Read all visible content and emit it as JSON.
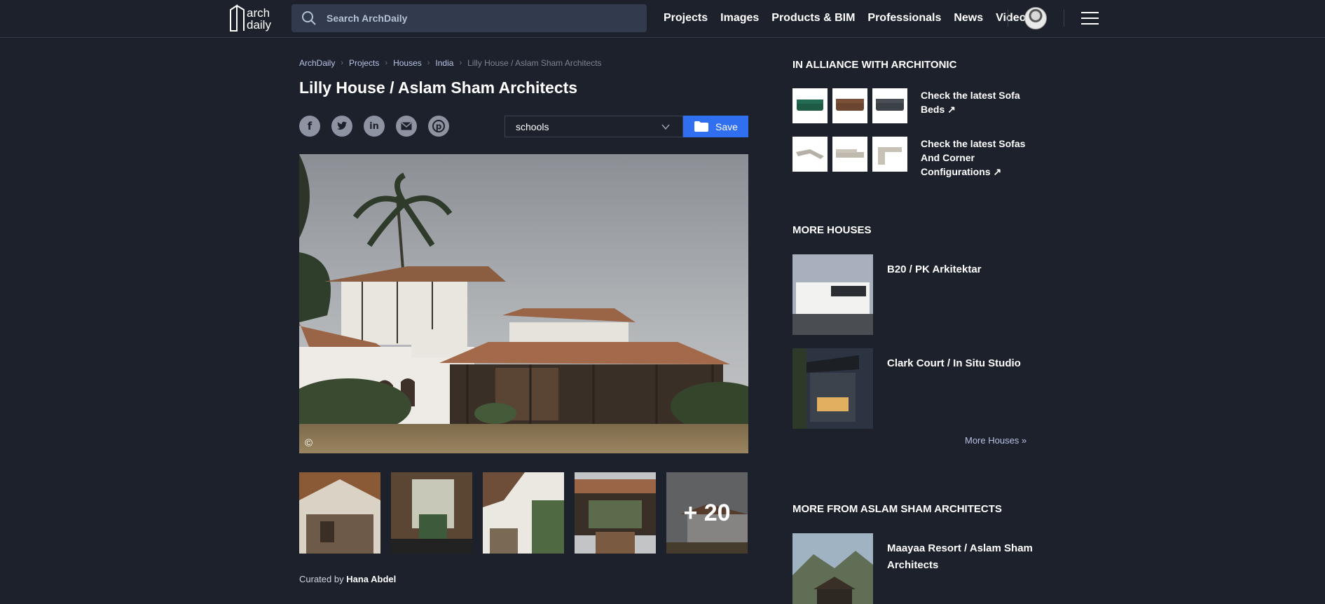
{
  "header": {
    "logo_line1": "arch",
    "logo_line2": "daily",
    "search_placeholder": "Search ArchDaily",
    "nav": [
      "Projects",
      "Images",
      "Products & BIM",
      "Professionals",
      "News",
      "Videos"
    ]
  },
  "breadcrumb": [
    "ArchDaily",
    "Projects",
    "Houses",
    "India",
    "Lilly House / Aslam Sham Architects"
  ],
  "title": "Lilly House / Aslam Sham Architects",
  "share_icons": [
    "facebook-icon",
    "twitter-icon",
    "linkedin-icon",
    "email-icon",
    "pinterest-icon"
  ],
  "folder_select": {
    "value": "schools"
  },
  "save_label": "Save",
  "main_image": {
    "copyright": "©"
  },
  "thumbs": {
    "more_count": "+ 20"
  },
  "curated": {
    "prefix": "Curated by ",
    "name": "Hana Abdel"
  },
  "sidebar": {
    "alliance": {
      "heading": "IN ALLIANCE WITH ARCHITONIC",
      "rows": [
        {
          "text": "Check the latest Sofa Beds"
        },
        {
          "text": "Check the latest Sofas And Corner Configurations"
        }
      ]
    },
    "more_houses": {
      "heading": "MORE HOUSES",
      "items": [
        {
          "title": "B20 / PK Arkitektar"
        },
        {
          "title": "Clark Court / In Situ Studio"
        }
      ],
      "link": "More Houses »"
    },
    "more_from": {
      "heading": "MORE FROM ASLAM SHAM ARCHITECTS",
      "items": [
        {
          "title": "Maayaa Resort / Aslam Sham Architects"
        }
      ]
    }
  },
  "colors": {
    "background": "#1d212b",
    "accent": "#2f6ff0",
    "link": "#b7c3e6"
  }
}
